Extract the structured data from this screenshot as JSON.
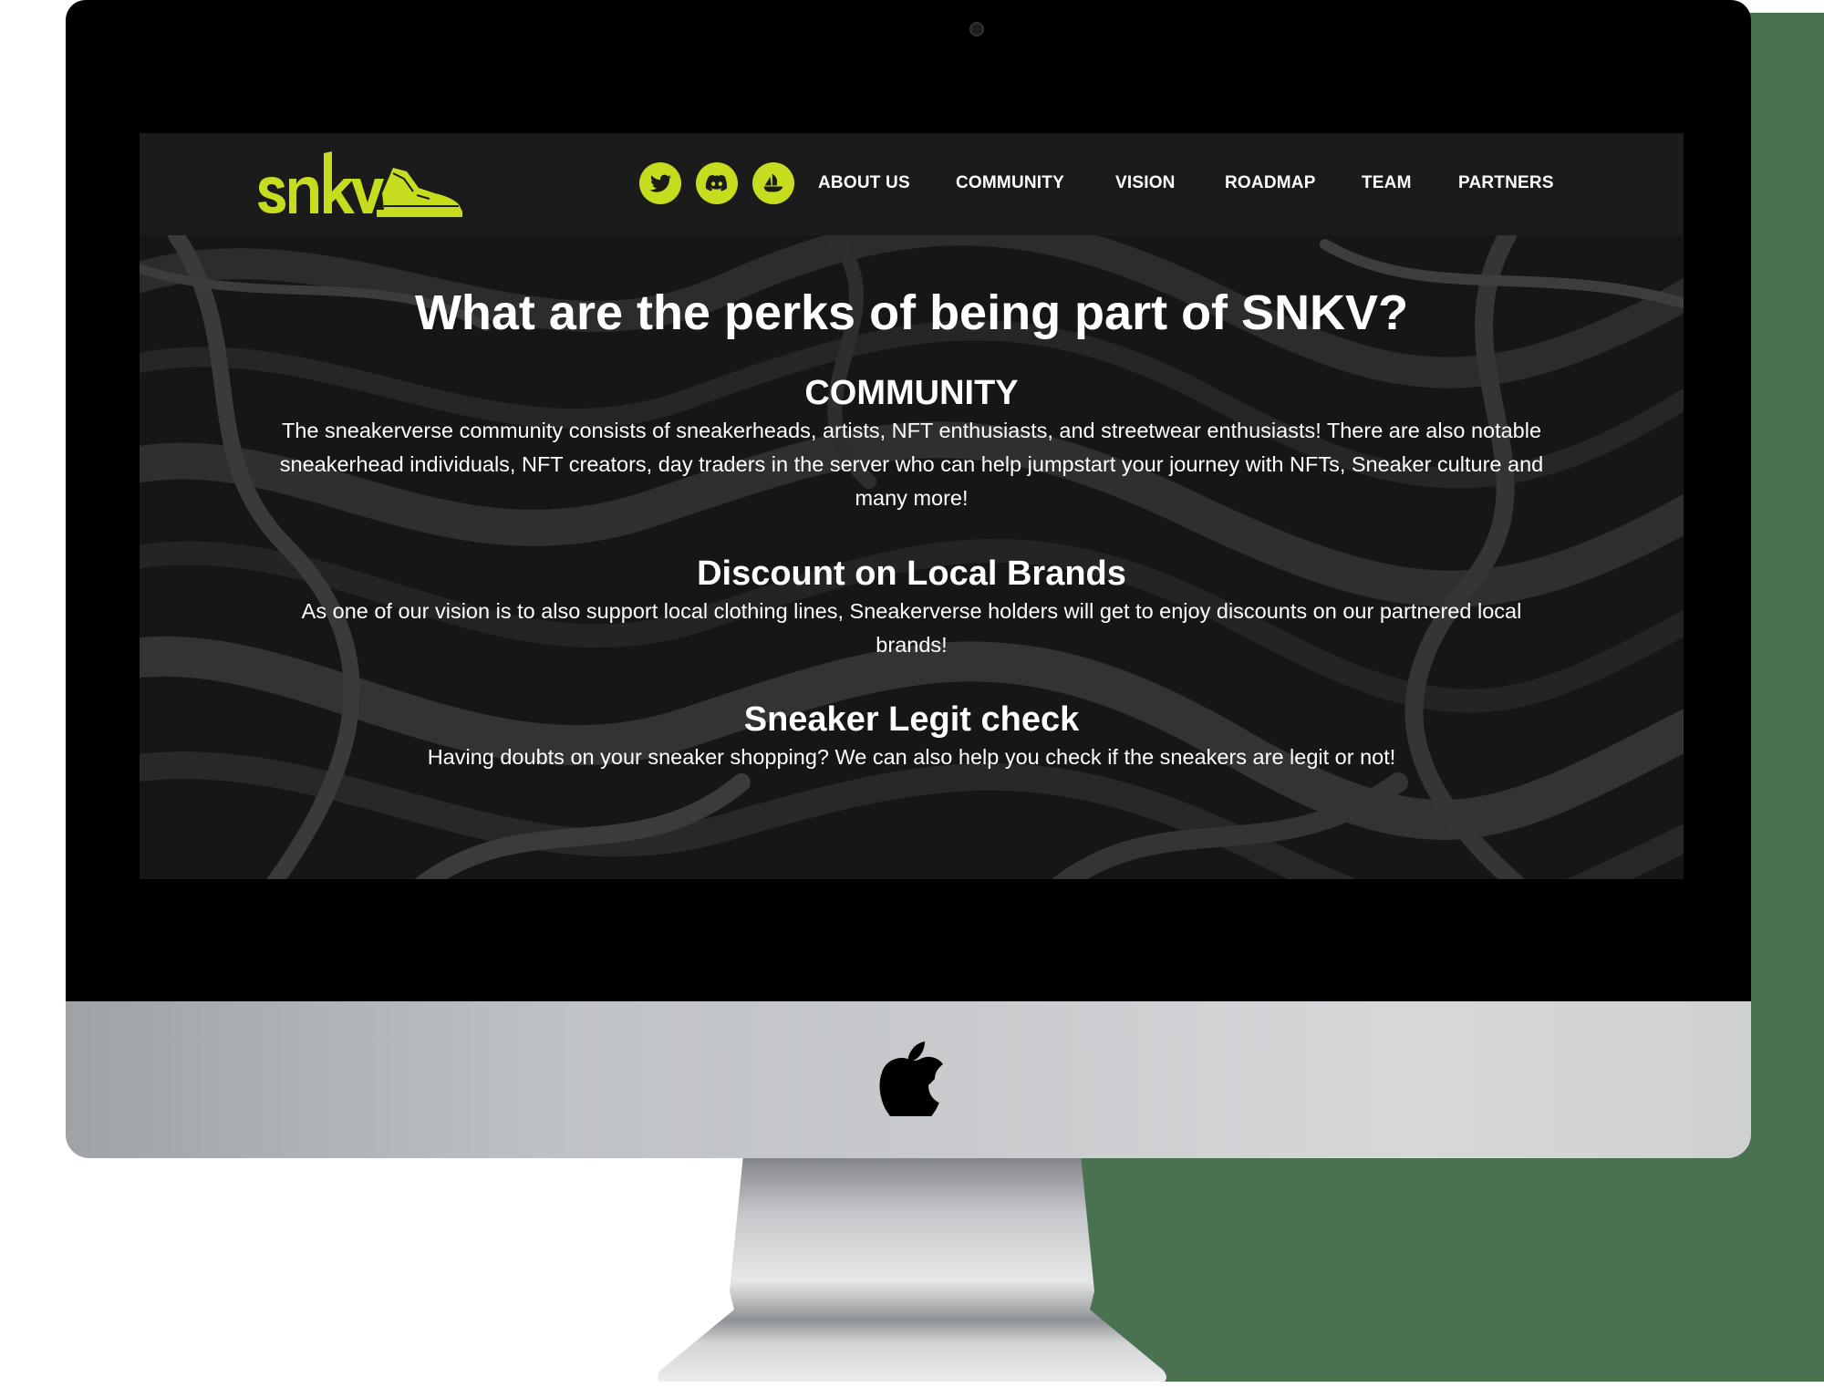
{
  "brand": {
    "logo_text": "snkv",
    "accent_color": "#c6dc1e"
  },
  "social": [
    {
      "icon": "twitter-icon"
    },
    {
      "icon": "discord-icon"
    },
    {
      "icon": "opensea-icon"
    }
  ],
  "nav": {
    "items": [
      {
        "label": "ABOUT US"
      },
      {
        "label": "COMMUNITY"
      },
      {
        "label": "VISION"
      },
      {
        "label": "ROADMAP"
      },
      {
        "label": "TEAM"
      },
      {
        "label": "PARTNERS"
      }
    ]
  },
  "main": {
    "title": "What are the perks of being part of SNKV?",
    "perks": [
      {
        "title": "COMMUNITY",
        "text": "The sneakerverse community consists of sneakerheads, artists, NFT enthusiasts, and streetwear enthusiasts! There are also notable sneakerhead individuals, NFT creators, day traders in the server who can help jumpstart your journey with NFTs, Sneaker culture and many more!"
      },
      {
        "title": "Discount on Local Brands",
        "text": "As one of our vision is to also support local clothing lines, Sneakerverse holders will get to enjoy discounts on our partnered local brands!"
      },
      {
        "title": "Sneaker Legit check",
        "text": "Having doubts on your sneaker shopping? We can also help you check if the sneakers are legit or not!"
      }
    ]
  },
  "device": {
    "logo_icon": "apple-icon"
  }
}
